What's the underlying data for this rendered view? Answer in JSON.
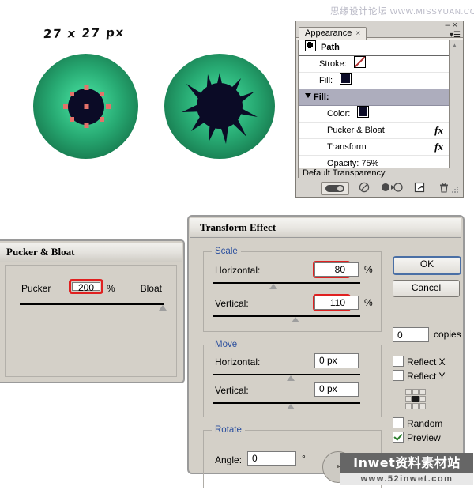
{
  "watermark_top": {
    "chinese": "思缘设计论坛",
    "url": "WWW.MISSYUAN.COM"
  },
  "canvas": {
    "size_label": "27 x 27 px"
  },
  "appearance_panel": {
    "tab_label": "Appearance",
    "tab_close": "×",
    "minimize": "–",
    "close": "×",
    "menu_icon": "panel-menu-icon",
    "rows": [
      {
        "label": "Path",
        "type": "header"
      },
      {
        "label": "Stroke:",
        "type": "swatch-none"
      },
      {
        "label": "Fill:",
        "type": "swatch-fill"
      },
      {
        "label": "Fill:",
        "type": "selected"
      },
      {
        "label": "Color:",
        "type": "swatch-color"
      },
      {
        "label": "Pucker & Bloat",
        "type": "effect",
        "fx": "fx"
      },
      {
        "label": "Transform",
        "type": "effect",
        "fx": "fx"
      },
      {
        "label": "Opacity: 75%",
        "type": "plain"
      }
    ],
    "default_transparency": "Default Transparency",
    "toolbar": {
      "basic_appearance": "new-art-basic-appearance",
      "clear": "clear-appearance",
      "duplicate": "duplicate-item",
      "new_art": "new-art",
      "delete": "delete-item"
    },
    "colors": {
      "fill_swatch": "#0c0c28",
      "selected_row": "#adadbd"
    }
  },
  "pucker_dialog": {
    "title": "Pucker & Bloat",
    "label_left": "Pucker",
    "label_right": "Bloat",
    "value": "200",
    "unit": "%",
    "slider_position_pct": 100,
    "highlight_color": "#e02020"
  },
  "transform_dialog": {
    "title": "Transform Effect",
    "scale": {
      "legend": "Scale",
      "horizontal_label": "Horizontal:",
      "horizontal_value": "80",
      "horizontal_unit": "%",
      "horizontal_slider_pct": 40,
      "vertical_label": "Vertical:",
      "vertical_value": "110",
      "vertical_unit": "%",
      "vertical_slider_pct": 55
    },
    "move": {
      "legend": "Move",
      "horizontal_label": "Horizontal:",
      "horizontal_value": "0 px",
      "horizontal_slider_pct": 50,
      "vertical_label": "Vertical:",
      "vertical_value": "0 px",
      "vertical_slider_pct": 50
    },
    "rotate": {
      "legend": "Rotate",
      "angle_label": "Angle:",
      "angle_value": "0",
      "degree_symbol": "°"
    },
    "buttons": {
      "ok": "OK",
      "cancel": "Cancel"
    },
    "copies_value": "0",
    "copies_label": "copies",
    "checkboxes": [
      {
        "label": "Reflect X",
        "checked": false
      },
      {
        "label": "Reflect Y",
        "checked": false
      },
      {
        "label": "Random",
        "checked": false
      },
      {
        "label": "Preview",
        "checked": true
      }
    ],
    "anchor_grid": "reference-point-center",
    "highlight_color": "#e02020"
  },
  "watermark_bottom": {
    "line1": "Inwet资料素材站",
    "line2": "www.52inwet.com"
  },
  "artwork": {
    "left_eye": {
      "name": "green-eye-pucker",
      "iris_outer": "#105c3b",
      "iris_inner": "#4fe0a0",
      "pupil": "#0b0b26",
      "anchor_color": "#e4726a",
      "anchor_count": 8
    },
    "right_eye": {
      "name": "green-eye-star-pupil",
      "iris_outer": "#0f5838",
      "iris_inner": "#4fe0a0",
      "pupil": "#0b0b26",
      "spike_count": 8
    }
  }
}
